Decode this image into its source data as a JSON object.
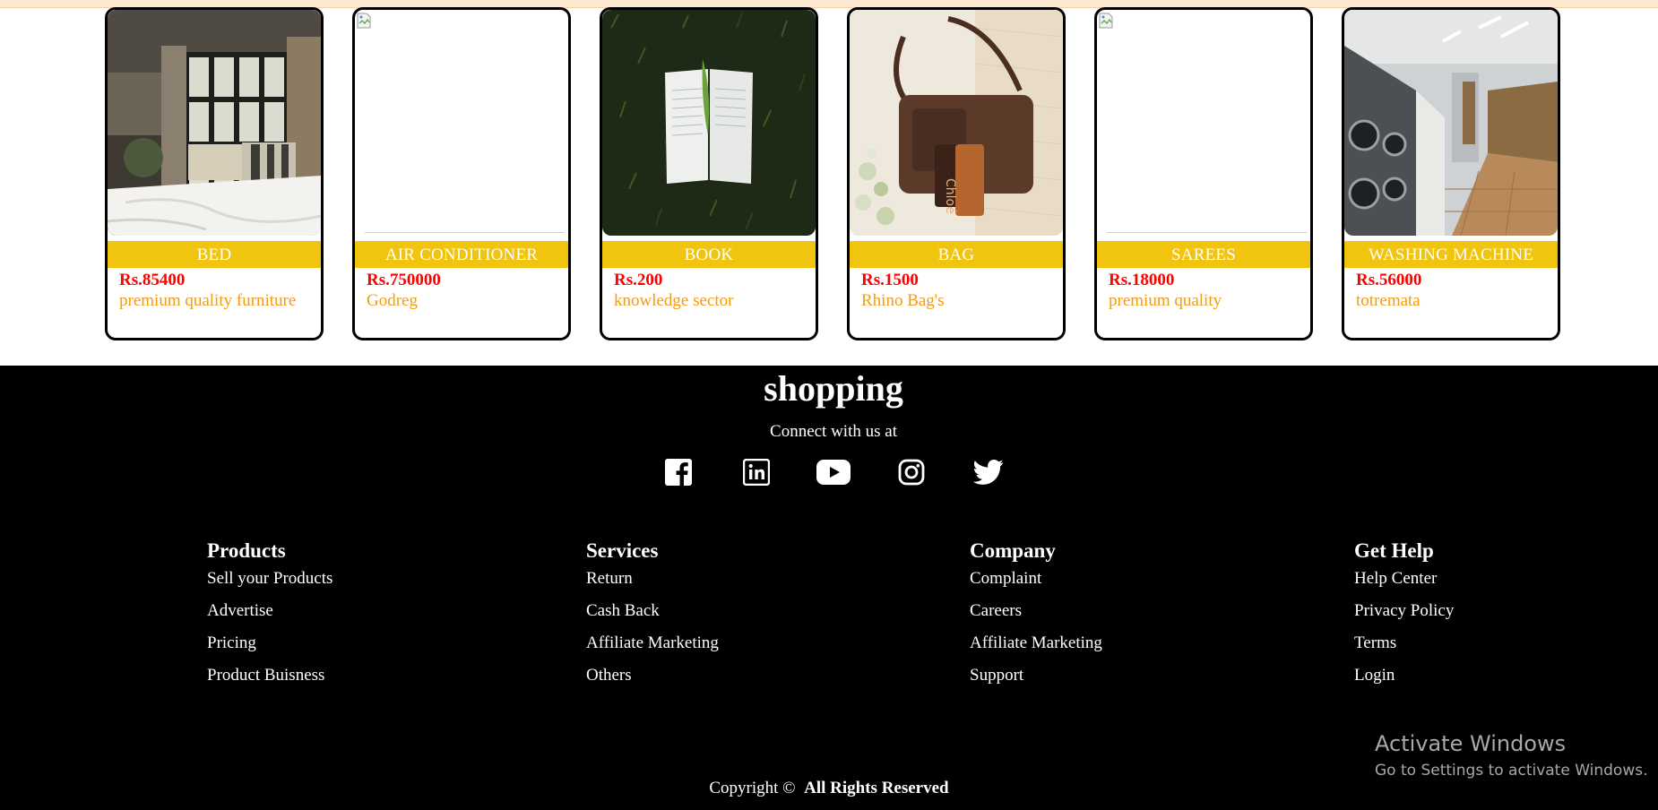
{
  "products": [
    {
      "name": "BED",
      "price": "Rs.85400",
      "desc": "premium quality furniture",
      "image": "bedroom-photo"
    },
    {
      "name": "AIR CONDITIONER",
      "price": "Rs.750000",
      "desc": "Godreg",
      "image": "broken-image"
    },
    {
      "name": "BOOK",
      "price": "Rs.200",
      "desc": "knowledge sector",
      "image": "book-photo"
    },
    {
      "name": "BAG",
      "price": "Rs.1500",
      "desc": "Rhino Bag's",
      "image": "handbag-photo"
    },
    {
      "name": "SAREES",
      "price": "Rs.18000",
      "desc": "premium quality",
      "image": "broken-image"
    },
    {
      "name": "WASHING MACHINE",
      "price": "Rs.56000",
      "desc": "totremata",
      "image": "laundromat-photo"
    }
  ],
  "footer": {
    "brand": "shopping",
    "connect": "Connect with us at",
    "socials": [
      "facebook-icon",
      "linkedin-icon",
      "youtube-icon",
      "instagram-icon",
      "twitter-icon"
    ],
    "columns": [
      {
        "title": "Products",
        "links": [
          "Sell your Products",
          "Advertise",
          "Pricing",
          "Product Buisness"
        ]
      },
      {
        "title": "Services",
        "links": [
          "Return",
          "Cash Back",
          "Affiliate Marketing",
          "Others"
        ]
      },
      {
        "title": "Company",
        "links": [
          "Complaint",
          "Careers",
          "Affiliate Marketing",
          "Support"
        ]
      },
      {
        "title": "Get Help",
        "links": [
          "Help Center",
          "Privacy Policy",
          "Terms",
          "Login"
        ]
      }
    ],
    "copyright": "Copyright ©",
    "rights": "All Rights Reserved"
  },
  "watermark": {
    "title": "Activate Windows",
    "subtitle": "Go to Settings to activate Windows."
  },
  "colors": {
    "name_band": "#f0c40f",
    "price": "#ff0000",
    "desc": "#f39c12",
    "footer_bg": "#000000"
  }
}
